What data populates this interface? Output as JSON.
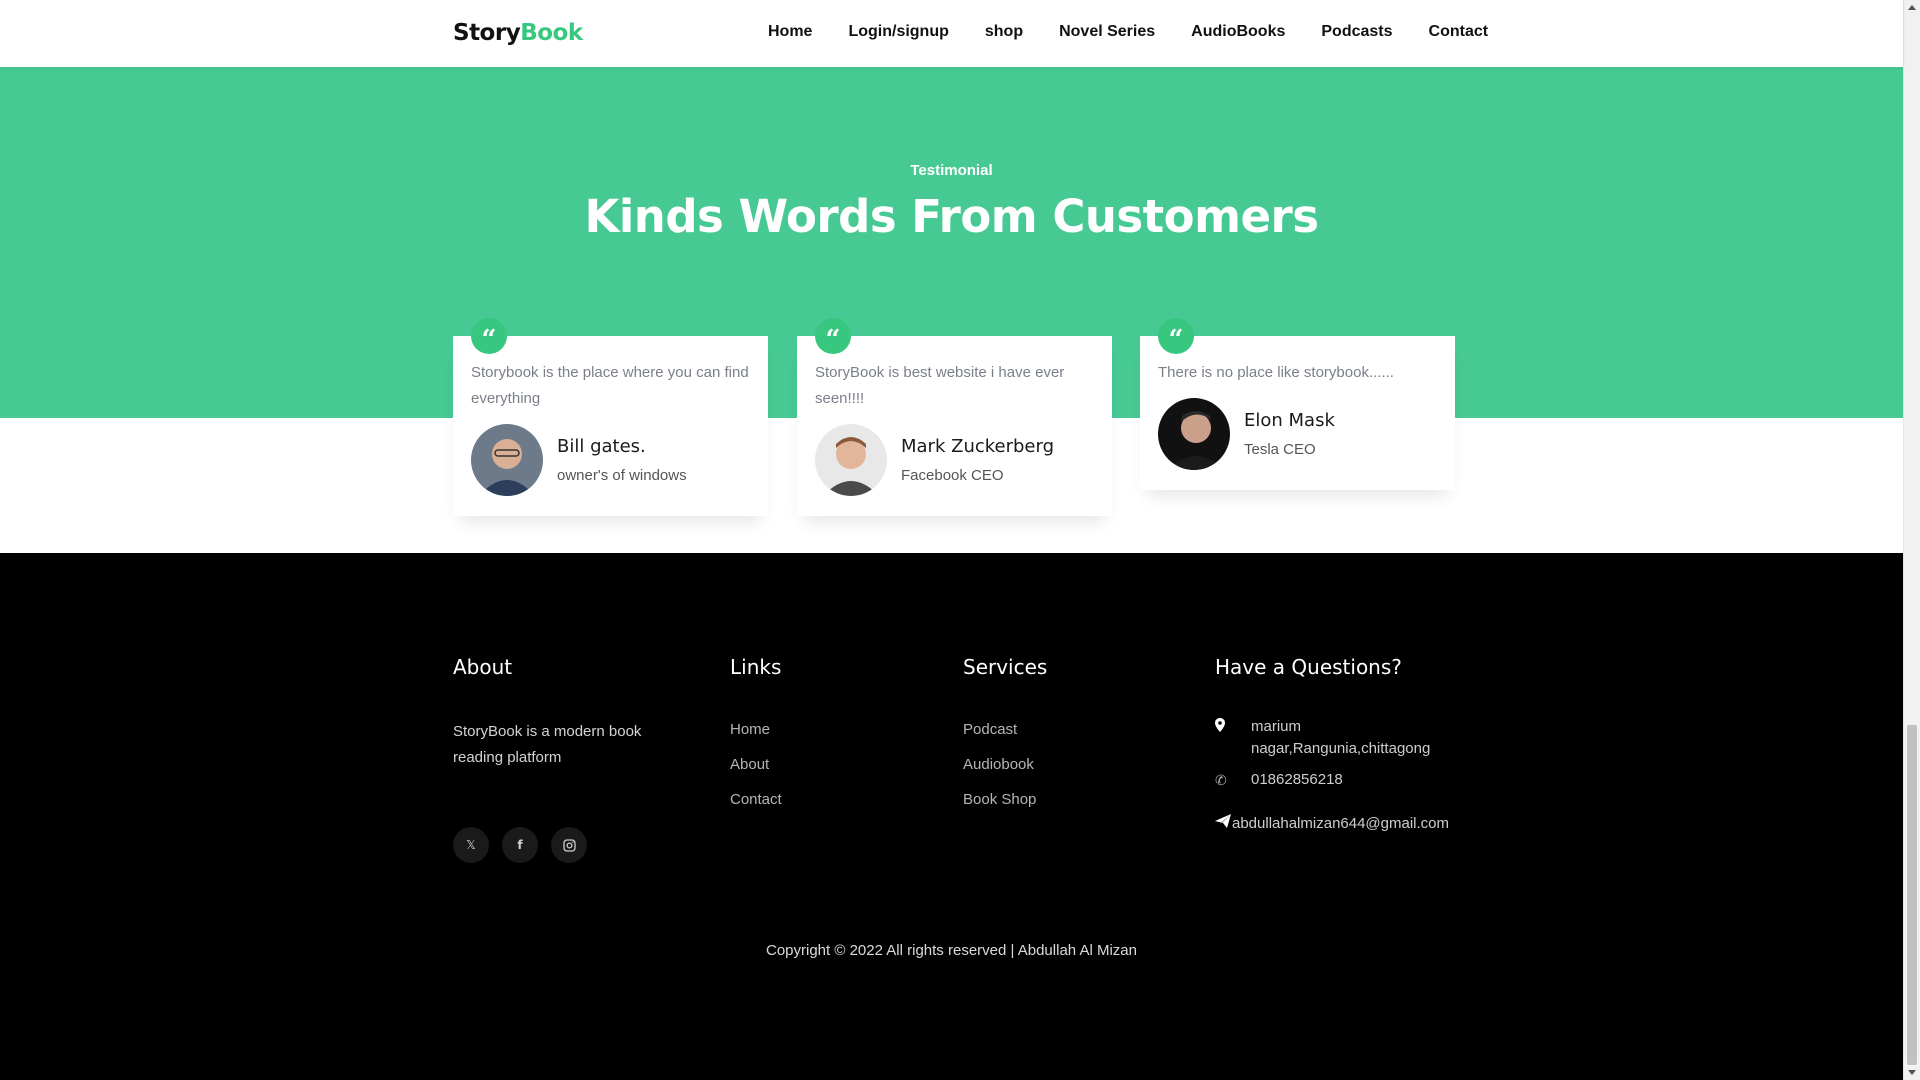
{
  "brand": {
    "part1": "Story",
    "part2": "Book"
  },
  "nav": [
    "Home",
    "Login/signup",
    "shop",
    "Novel Series",
    "AudioBooks",
    "Podcasts",
    "Contact"
  ],
  "hero": {
    "eyebrow": "Testimonial",
    "heading": "Kinds Words From Customers"
  },
  "quote_icon": "quote-left-icon",
  "testimonials": [
    {
      "text": "Storybook is the place where you can find everything",
      "name": "Bill gates.",
      "role": "owner's of windows"
    },
    {
      "text": "StoryBook is best website i have ever seen!!!!",
      "name": "Mark Zuckerberg",
      "role": "Facebook CEO"
    },
    {
      "text": "There is no place like storybook......",
      "name": "Elon Mask",
      "role": "Tesla CEO"
    }
  ],
  "footer": {
    "about": {
      "title": "About",
      "text": "StoryBook is a modern book reading platform"
    },
    "links": {
      "title": "Links",
      "items": [
        "Home",
        "About",
        "Contact"
      ]
    },
    "services": {
      "title": "Services",
      "items": [
        "Podcast",
        "Audiobook",
        "Book Shop"
      ]
    },
    "contact": {
      "title": "Have a Questions?",
      "address": "marium nagar,Rangunia,chittagong",
      "phone": "01862856218",
      "email": "abdullahalmizan644@gmail.com"
    },
    "social": [
      "twitter-icon",
      "facebook-icon",
      "instagram-icon"
    ],
    "copyright": "Copyright © 2022 All rights reserved | Abdullah Al Mizan"
  },
  "colors": {
    "accent": "#37c77f",
    "hero_bg": "#47c993",
    "footer_bg": "#000000"
  }
}
